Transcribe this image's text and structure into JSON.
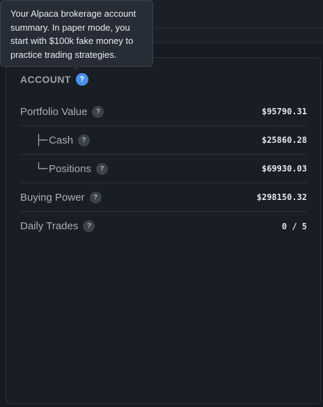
{
  "tooltip": {
    "text": "Your Alpaca brokerage account summary. In paper mode, you start with $100k fake money to practice trading strategies."
  },
  "account": {
    "title": "ACCOUNT",
    "help_glyph": "?",
    "rows": [
      {
        "label": "Portfolio Value",
        "prefix": "",
        "value": "$95790.31",
        "help": "?"
      },
      {
        "label": "Cash",
        "prefix": "├─",
        "value": "$25860.28",
        "help": "?"
      },
      {
        "label": "Positions",
        "prefix": "└─",
        "value": "$69930.03",
        "help": "?"
      },
      {
        "label": "Buying Power",
        "prefix": "",
        "value": "$298150.32",
        "help": "?"
      },
      {
        "label": "Daily Trades",
        "prefix": "",
        "value": "0 / 5",
        "help": "?"
      }
    ]
  },
  "icons": {
    "help": "question-circle-icon"
  },
  "colors": {
    "background": "#161a22",
    "panel": "#191d24",
    "accent": "#4a92e8",
    "tooltip": "#272d37"
  }
}
